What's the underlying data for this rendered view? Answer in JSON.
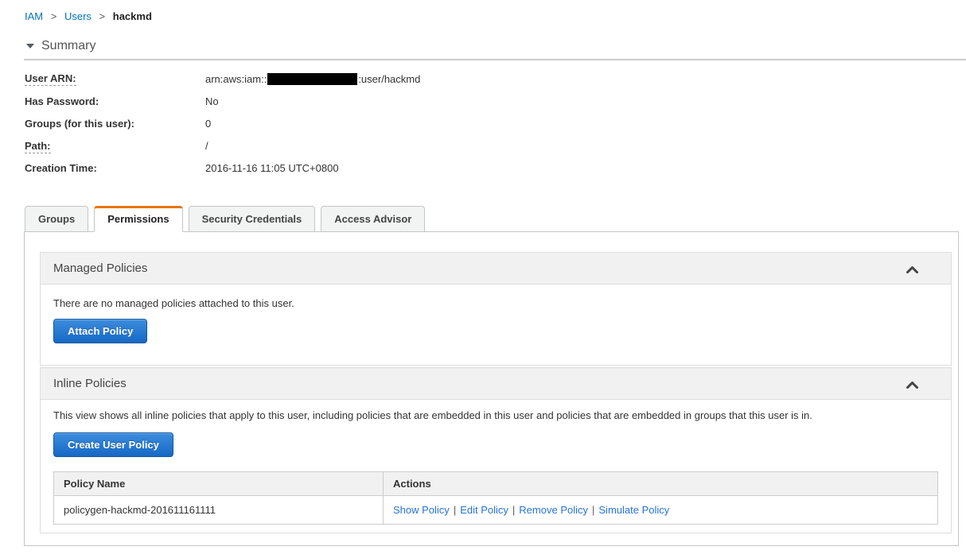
{
  "breadcrumb": {
    "separator": ">",
    "iam": "IAM",
    "users": "Users",
    "current": "hackmd"
  },
  "summary": {
    "title": "Summary",
    "user_arn": {
      "label": "User ARN:",
      "value_prefix": "arn:aws:iam::",
      "value_suffix": ":user/hackmd"
    },
    "has_password": {
      "label": "Has Password:",
      "value": "No"
    },
    "groups": {
      "label": "Groups (for this user):",
      "value": "0"
    },
    "path": {
      "label": "Path:",
      "value": "/"
    },
    "creation_time": {
      "label": "Creation Time:",
      "value": "2016-11-16 11:05 UTC+0800"
    }
  },
  "tabs": {
    "items": [
      {
        "label": "Groups",
        "active": false
      },
      {
        "label": "Permissions",
        "active": true
      },
      {
        "label": "Security Credentials",
        "active": false
      },
      {
        "label": "Access Advisor",
        "active": false
      }
    ]
  },
  "managed_policies": {
    "title": "Managed Policies",
    "empty_text": "There are no managed policies attached to this user.",
    "attach_button": "Attach Policy"
  },
  "inline_policies": {
    "title": "Inline Policies",
    "description": "This view shows all inline policies that apply to this user, including policies that are embedded in this user and policies that are embedded in groups that this user is in.",
    "create_button": "Create User Policy",
    "table": {
      "headers": [
        "Policy Name",
        "Actions"
      ],
      "actions_separator": "|",
      "rows": [
        {
          "policy_name": "policygen-hackmd-201611161111",
          "actions": [
            "Show Policy",
            "Edit Policy",
            "Remove Policy",
            "Simulate Policy"
          ]
        }
      ]
    }
  },
  "colors": {
    "accent_orange": "#e87511",
    "link_blue": "#0073bb",
    "action_link_blue": "#2673dc",
    "btn_top": "#3c8dde",
    "btn_bottom": "#1668c4",
    "btn_border": "#15589e"
  }
}
